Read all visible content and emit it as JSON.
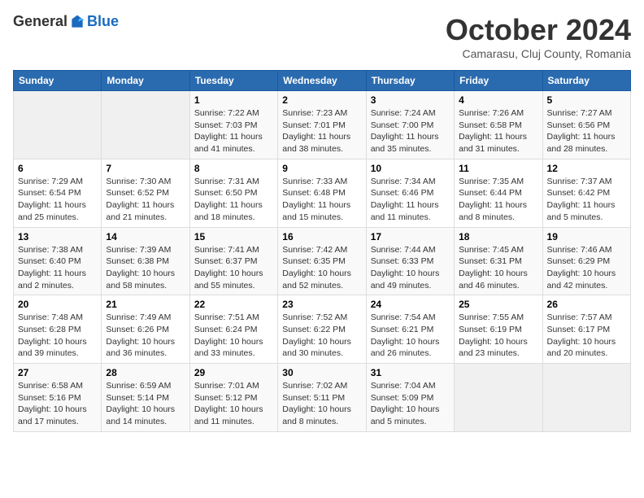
{
  "header": {
    "logo_general": "General",
    "logo_blue": "Blue",
    "month_title": "October 2024",
    "location": "Camarasu, Cluj County, Romania"
  },
  "days_of_week": [
    "Sunday",
    "Monday",
    "Tuesday",
    "Wednesday",
    "Thursday",
    "Friday",
    "Saturday"
  ],
  "weeks": [
    [
      {
        "day": "",
        "info": ""
      },
      {
        "day": "",
        "info": ""
      },
      {
        "day": "1",
        "info": "Sunrise: 7:22 AM\nSunset: 7:03 PM\nDaylight: 11 hours and 41 minutes."
      },
      {
        "day": "2",
        "info": "Sunrise: 7:23 AM\nSunset: 7:01 PM\nDaylight: 11 hours and 38 minutes."
      },
      {
        "day": "3",
        "info": "Sunrise: 7:24 AM\nSunset: 7:00 PM\nDaylight: 11 hours and 35 minutes."
      },
      {
        "day": "4",
        "info": "Sunrise: 7:26 AM\nSunset: 6:58 PM\nDaylight: 11 hours and 31 minutes."
      },
      {
        "day": "5",
        "info": "Sunrise: 7:27 AM\nSunset: 6:56 PM\nDaylight: 11 hours and 28 minutes."
      }
    ],
    [
      {
        "day": "6",
        "info": "Sunrise: 7:29 AM\nSunset: 6:54 PM\nDaylight: 11 hours and 25 minutes."
      },
      {
        "day": "7",
        "info": "Sunrise: 7:30 AM\nSunset: 6:52 PM\nDaylight: 11 hours and 21 minutes."
      },
      {
        "day": "8",
        "info": "Sunrise: 7:31 AM\nSunset: 6:50 PM\nDaylight: 11 hours and 18 minutes."
      },
      {
        "day": "9",
        "info": "Sunrise: 7:33 AM\nSunset: 6:48 PM\nDaylight: 11 hours and 15 minutes."
      },
      {
        "day": "10",
        "info": "Sunrise: 7:34 AM\nSunset: 6:46 PM\nDaylight: 11 hours and 11 minutes."
      },
      {
        "day": "11",
        "info": "Sunrise: 7:35 AM\nSunset: 6:44 PM\nDaylight: 11 hours and 8 minutes."
      },
      {
        "day": "12",
        "info": "Sunrise: 7:37 AM\nSunset: 6:42 PM\nDaylight: 11 hours and 5 minutes."
      }
    ],
    [
      {
        "day": "13",
        "info": "Sunrise: 7:38 AM\nSunset: 6:40 PM\nDaylight: 11 hours and 2 minutes."
      },
      {
        "day": "14",
        "info": "Sunrise: 7:39 AM\nSunset: 6:38 PM\nDaylight: 10 hours and 58 minutes."
      },
      {
        "day": "15",
        "info": "Sunrise: 7:41 AM\nSunset: 6:37 PM\nDaylight: 10 hours and 55 minutes."
      },
      {
        "day": "16",
        "info": "Sunrise: 7:42 AM\nSunset: 6:35 PM\nDaylight: 10 hours and 52 minutes."
      },
      {
        "day": "17",
        "info": "Sunrise: 7:44 AM\nSunset: 6:33 PM\nDaylight: 10 hours and 49 minutes."
      },
      {
        "day": "18",
        "info": "Sunrise: 7:45 AM\nSunset: 6:31 PM\nDaylight: 10 hours and 46 minutes."
      },
      {
        "day": "19",
        "info": "Sunrise: 7:46 AM\nSunset: 6:29 PM\nDaylight: 10 hours and 42 minutes."
      }
    ],
    [
      {
        "day": "20",
        "info": "Sunrise: 7:48 AM\nSunset: 6:28 PM\nDaylight: 10 hours and 39 minutes."
      },
      {
        "day": "21",
        "info": "Sunrise: 7:49 AM\nSunset: 6:26 PM\nDaylight: 10 hours and 36 minutes."
      },
      {
        "day": "22",
        "info": "Sunrise: 7:51 AM\nSunset: 6:24 PM\nDaylight: 10 hours and 33 minutes."
      },
      {
        "day": "23",
        "info": "Sunrise: 7:52 AM\nSunset: 6:22 PM\nDaylight: 10 hours and 30 minutes."
      },
      {
        "day": "24",
        "info": "Sunrise: 7:54 AM\nSunset: 6:21 PM\nDaylight: 10 hours and 26 minutes."
      },
      {
        "day": "25",
        "info": "Sunrise: 7:55 AM\nSunset: 6:19 PM\nDaylight: 10 hours and 23 minutes."
      },
      {
        "day": "26",
        "info": "Sunrise: 7:57 AM\nSunset: 6:17 PM\nDaylight: 10 hours and 20 minutes."
      }
    ],
    [
      {
        "day": "27",
        "info": "Sunrise: 6:58 AM\nSunset: 5:16 PM\nDaylight: 10 hours and 17 minutes."
      },
      {
        "day": "28",
        "info": "Sunrise: 6:59 AM\nSunset: 5:14 PM\nDaylight: 10 hours and 14 minutes."
      },
      {
        "day": "29",
        "info": "Sunrise: 7:01 AM\nSunset: 5:12 PM\nDaylight: 10 hours and 11 minutes."
      },
      {
        "day": "30",
        "info": "Sunrise: 7:02 AM\nSunset: 5:11 PM\nDaylight: 10 hours and 8 minutes."
      },
      {
        "day": "31",
        "info": "Sunrise: 7:04 AM\nSunset: 5:09 PM\nDaylight: 10 hours and 5 minutes."
      },
      {
        "day": "",
        "info": ""
      },
      {
        "day": "",
        "info": ""
      }
    ]
  ]
}
